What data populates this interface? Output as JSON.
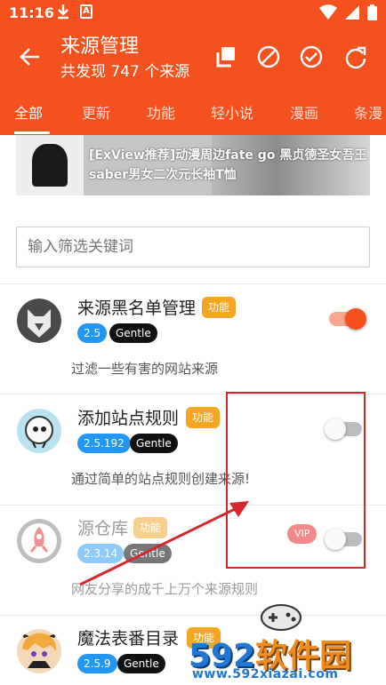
{
  "status_bar": {
    "time": "11:16",
    "sb_icon_a": "A"
  },
  "app_bar": {
    "title": "来源管理",
    "subtitle": "共发现 747 个来源",
    "actions": [
      "copy-icon",
      "block-icon",
      "check-circle-icon",
      "refresh-icon"
    ]
  },
  "tabs": [
    {
      "label": "全部",
      "active": true
    },
    {
      "label": "更新",
      "active": false
    },
    {
      "label": "功能",
      "active": false
    },
    {
      "label": "轻小说",
      "active": false
    },
    {
      "label": "漫画",
      "active": false
    },
    {
      "label": "条漫",
      "active": false
    }
  ],
  "banner": {
    "text": "[ExView推荐]动漫周边fate go 黑贞德圣女吾王saber男女二次元长袖T恤"
  },
  "search": {
    "placeholder": "输入筛选关键词"
  },
  "sources": [
    {
      "name": "来源黑名单管理",
      "tag": "功能",
      "version": "2.5",
      "license": "Gentle",
      "description": "过滤一些有害的网站来源",
      "enabled": true,
      "vip": ""
    },
    {
      "name": "添加站点规则",
      "tag": "功能",
      "version": "2.5.192",
      "license": "Gentle",
      "description": "通过简单的站点规则创建来源!",
      "enabled": false,
      "vip": ""
    },
    {
      "name": "源仓库",
      "tag": "功能",
      "version": "2.3.14",
      "license": "Gentle",
      "description": "网友分享的成千上万个来源规则",
      "enabled": false,
      "vip": "VIP"
    },
    {
      "name": "魔法表番目录",
      "tag": "功能",
      "version": "2.5.9",
      "license": "Gentle",
      "description": "",
      "enabled": false,
      "vip": ""
    }
  ],
  "watermark": {
    "logo_num": "592",
    "logo_cn": "软件园",
    "url": "www.592xiazai.com"
  },
  "colors": {
    "primary": "#f4511e",
    "tag": "#f5a623",
    "version": "#2196f3",
    "license": "#111111",
    "annotation": "#d8262f"
  }
}
